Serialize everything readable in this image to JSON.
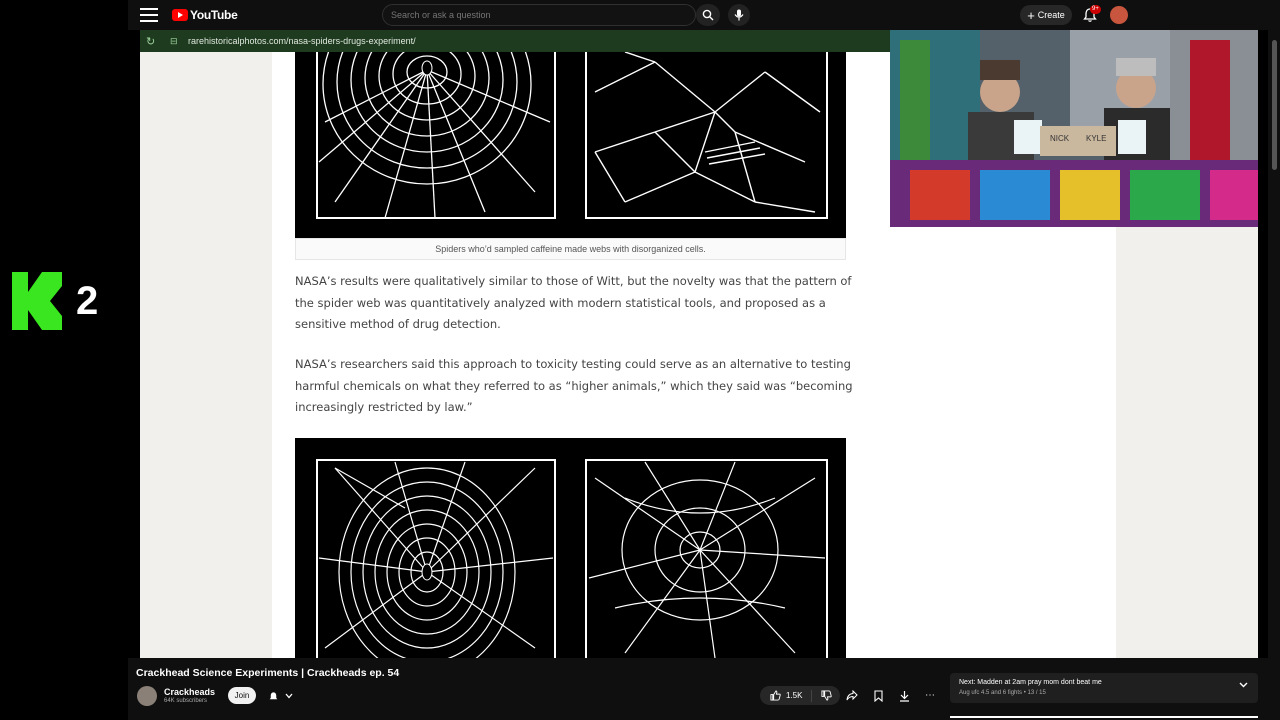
{
  "overlay": {
    "logo_text": "2"
  },
  "youtube": {
    "logo_text": "YouTube",
    "search_placeholder": "Search or ask a question",
    "create_label": "Create",
    "notification_count": "9+"
  },
  "browser": {
    "url": "rarehistoricalphotos.com/nasa-spiders-drugs-experiment/"
  },
  "article": {
    "caption": "Spiders who’d sampled caffeine made webs with disorganized cells.",
    "paragraph1": "NASA’s results were qualitatively similar to those of Witt, but the novelty was that the pattern of the spider web was quantitatively analyzed with modern statistical tools, and proposed as a sensitive method of drug detection.",
    "paragraph2": "NASA’s researchers said this approach to toxicity testing could serve as an alternative to testing harmful chemicals on what they referred to as “higher animals,” which they said was “becoming increasingly restricted by law.”"
  },
  "webcam": {
    "sign_left": "NICK",
    "sign_right": "KYLE"
  },
  "video": {
    "title": "Crackhead Science Experiments | Crackheads ep. 54",
    "channel": "Crackheads",
    "subscribers": "64K subscribers",
    "join_label": "Join",
    "likes": "1.5K",
    "next_title": "Next: Madden at 2am pray mom dont beat me",
    "next_sub": "Aug ufc 4.5 and 6 fights • 13 / 15"
  },
  "colors": {
    "accent_green": "#39e61f",
    "youtube_red": "#ff0000",
    "page_bg": "#f2f0ec"
  }
}
